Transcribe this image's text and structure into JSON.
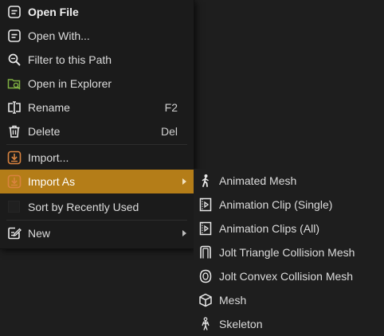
{
  "menu": {
    "items": [
      {
        "label": "Open File",
        "icon": "document-icon"
      },
      {
        "label": "Open With...",
        "icon": "document-icon"
      },
      {
        "label": "Filter to this Path",
        "icon": "search-icon"
      },
      {
        "label": "Open in Explorer",
        "icon": "folder-search-icon"
      },
      {
        "label": "Rename",
        "icon": "rename-icon",
        "shortcut": "F2"
      },
      {
        "label": "Delete",
        "icon": "trash-icon",
        "shortcut": "Del"
      },
      {
        "label": "Import...",
        "icon": "import-icon"
      },
      {
        "label": "Import As",
        "icon": "import-icon"
      },
      {
        "label": "Sort by Recently Used",
        "icon": "checkbox"
      },
      {
        "label": "New",
        "icon": "new-file-icon"
      }
    ]
  },
  "submenu": {
    "items": [
      {
        "label": "Animated Mesh",
        "icon": "walking-figure-icon"
      },
      {
        "label": "Animation Clip (Single)",
        "icon": "film-play-icon"
      },
      {
        "label": "Animation Clips (All)",
        "icon": "film-play-icon"
      },
      {
        "label": "Jolt Triangle Collision Mesh",
        "icon": "door-frame-icon"
      },
      {
        "label": "Jolt Convex Collision Mesh",
        "icon": "convex-hull-icon"
      },
      {
        "label": "Mesh",
        "icon": "cube-icon"
      },
      {
        "label": "Skeleton",
        "icon": "skeleton-icon"
      }
    ]
  },
  "colors": {
    "highlight": "#b47d18",
    "import_icon": "#d9833f",
    "explorer_icon": "#7fb043",
    "background": "#1e1e1e"
  }
}
